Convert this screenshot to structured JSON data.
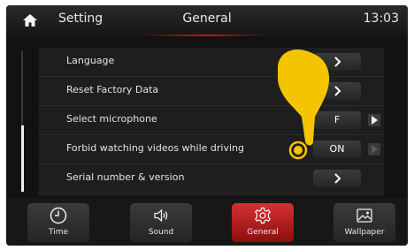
{
  "header": {
    "section": "Setting",
    "title": "General",
    "time": "13:03"
  },
  "settings": [
    {
      "label": "Language",
      "control": "chevron"
    },
    {
      "label": "Reset Factory Data",
      "control": "chevron"
    },
    {
      "label": "Select microphone",
      "control": "select",
      "value": "F"
    },
    {
      "label": "Forbid watching videos while driving",
      "control": "toggle",
      "value": "ON"
    },
    {
      "label": "Serial number & version",
      "control": "chevron"
    }
  ],
  "dock": [
    {
      "label": "Time",
      "icon": "clock-icon",
      "active": false
    },
    {
      "label": "Sound",
      "icon": "speaker-icon",
      "active": false
    },
    {
      "label": "General",
      "icon": "gear-icon",
      "active": true
    },
    {
      "label": "Wallpaper",
      "icon": "image-icon",
      "active": false
    }
  ],
  "overlay": {
    "icon": "pointing-hand-icon",
    "color": "#f5c400"
  }
}
